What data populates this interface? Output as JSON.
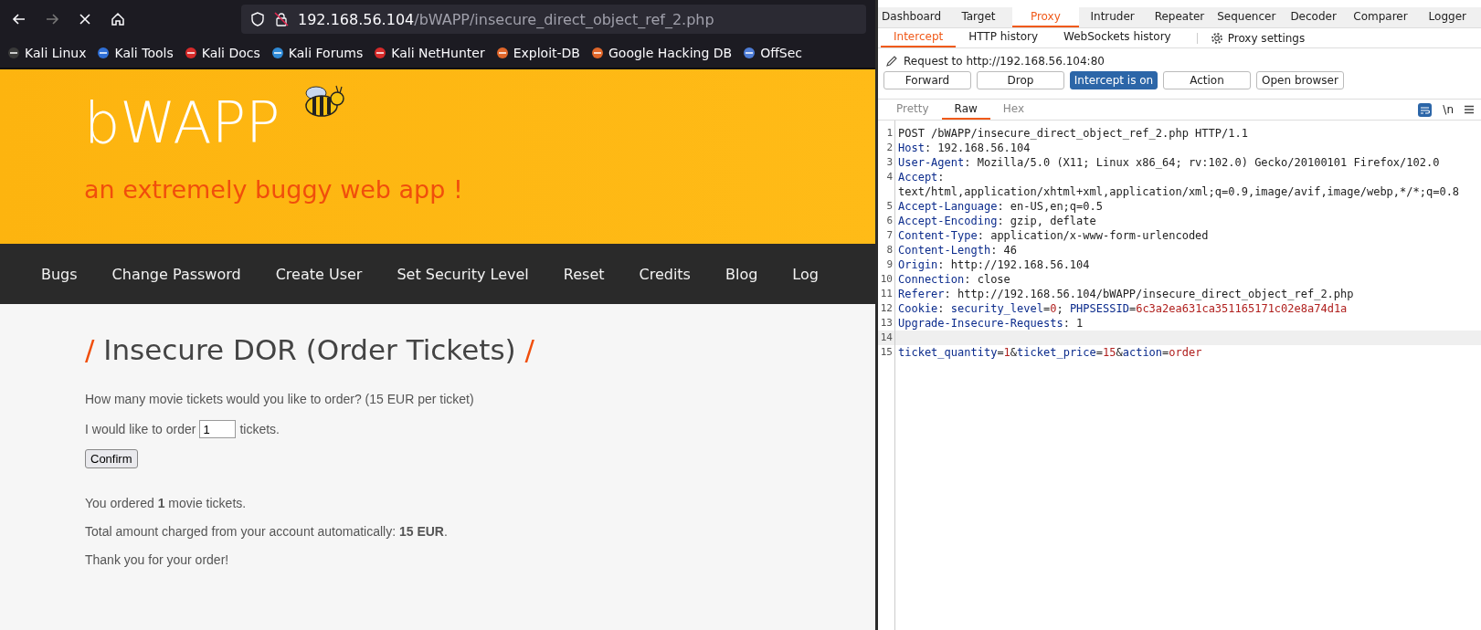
{
  "browser": {
    "url": {
      "host": "192.168.56.104",
      "path": "/bWAPP/insecure_direct_object_ref_2.php"
    },
    "bookmarks": [
      "Kali Linux",
      "Kali Tools",
      "Kali Docs",
      "Kali Forums",
      "Kali NetHunter",
      "Exploit-DB",
      "Google Hacking DB",
      "OffSec"
    ]
  },
  "site": {
    "logo": "bWAPP",
    "tagline": "an extremely buggy web app !",
    "nav": [
      "Bugs",
      "Change Password",
      "Create User",
      "Set Security Level",
      "Reset",
      "Credits",
      "Blog",
      "Log"
    ],
    "heading": {
      "slash": "/",
      "title": "Insecure DOR (Order Tickets)"
    },
    "question": "How many movie tickets would you like to order? (15 EUR per ticket)",
    "order_prefix": "I would like to order",
    "quantity": "1",
    "order_suffix": "tickets.",
    "confirm": "Confirm",
    "results": [
      "You ordered **1** movie tickets.",
      "Total amount charged from your account automatically: **15 EUR**.",
      "Thank you for your order!"
    ]
  },
  "burp": {
    "tabs": [
      {
        "label": "Dashboard",
        "selected": false
      },
      {
        "label": "Target",
        "selected": false
      },
      {
        "label": "Proxy",
        "selected": true
      },
      {
        "label": "Intruder",
        "selected": false
      },
      {
        "label": "Repeater",
        "selected": false
      },
      {
        "label": "Sequencer",
        "selected": false
      },
      {
        "label": "Decoder",
        "selected": false
      },
      {
        "label": "Comparer",
        "selected": false
      },
      {
        "label": "Logger",
        "selected": false
      }
    ],
    "subtabs": [
      {
        "label": "Intercept",
        "selected": true
      },
      {
        "label": "HTTP history",
        "selected": false
      },
      {
        "label": "WebSockets history",
        "selected": false
      }
    ],
    "settings": "Proxy settings",
    "request_to": "Request to http://192.168.56.104:80",
    "buttons": [
      {
        "label": "Forward",
        "on": false
      },
      {
        "label": "Drop",
        "on": false
      },
      {
        "label": "Intercept is on",
        "on": true
      },
      {
        "label": "Action",
        "on": false
      },
      {
        "label": "Open browser",
        "on": false
      }
    ],
    "editor_tabs": [
      {
        "label": "Pretty",
        "selected": false
      },
      {
        "label": "Raw",
        "selected": true
      },
      {
        "label": "Hex",
        "selected": false
      }
    ],
    "newline_toggle": "\\n",
    "lines": [
      {
        "number": "1",
        "highlighted": false,
        "segments": [
          {
            "kind": "plain",
            "text": "POST /bWAPP/insecure_direct_object_ref_2.php HTTP/1.1"
          }
        ]
      },
      {
        "number": "2",
        "highlighted": false,
        "segments": [
          {
            "kind": "key",
            "text": "Host"
          },
          {
            "kind": "plain",
            "text": ": 192.168.56.104"
          }
        ]
      },
      {
        "number": "3",
        "highlighted": false,
        "segments": [
          {
            "kind": "key",
            "text": "User-Agent"
          },
          {
            "kind": "plain",
            "text": ": Mozilla/5.0 (X11; Linux x86_64; rv:102.0) Gecko/20100101 Firefox/102.0"
          }
        ]
      },
      {
        "number": "4",
        "highlighted": false,
        "segments": [
          {
            "kind": "key",
            "text": "Accept"
          },
          {
            "kind": "plain",
            "text": ":"
          }
        ],
        "wrapped": "text/html,application/xhtml+xml,application/xml;q=0.9,image/avif,image/webp,*/*;q=0.8"
      },
      {
        "number": "5",
        "highlighted": false,
        "segments": [
          {
            "kind": "key",
            "text": "Accept-Language"
          },
          {
            "kind": "plain",
            "text": ": en-US,en;q=0.5"
          }
        ]
      },
      {
        "number": "6",
        "highlighted": false,
        "segments": [
          {
            "kind": "key",
            "text": "Accept-Encoding"
          },
          {
            "kind": "plain",
            "text": ": gzip, deflate"
          }
        ]
      },
      {
        "number": "7",
        "highlighted": false,
        "segments": [
          {
            "kind": "key",
            "text": "Content-Type"
          },
          {
            "kind": "plain",
            "text": ": application/x-www-form-urlencoded"
          }
        ]
      },
      {
        "number": "8",
        "highlighted": false,
        "segments": [
          {
            "kind": "key",
            "text": "Content-Length"
          },
          {
            "kind": "plain",
            "text": ": 46"
          }
        ]
      },
      {
        "number": "9",
        "highlighted": false,
        "segments": [
          {
            "kind": "key",
            "text": "Origin"
          },
          {
            "kind": "plain",
            "text": ": http://192.168.56.104"
          }
        ]
      },
      {
        "number": "10",
        "highlighted": false,
        "segments": [
          {
            "kind": "key",
            "text": "Connection"
          },
          {
            "kind": "plain",
            "text": ": close"
          }
        ]
      },
      {
        "number": "11",
        "highlighted": false,
        "segments": [
          {
            "kind": "key",
            "text": "Referer"
          },
          {
            "kind": "plain",
            "text": ": http://192.168.56.104/bWAPP/insecure_direct_object_ref_2.php"
          }
        ]
      },
      {
        "number": "12",
        "highlighted": false,
        "segments": [
          {
            "kind": "key",
            "text": "Cookie"
          },
          {
            "kind": "plain",
            "text": ": "
          },
          {
            "kind": "key",
            "text": "security_level"
          },
          {
            "kind": "plain",
            "text": "="
          },
          {
            "kind": "value",
            "text": "0"
          },
          {
            "kind": "plain",
            "text": "; "
          },
          {
            "kind": "key",
            "text": "PHPSESSID"
          },
          {
            "kind": "plain",
            "text": "="
          },
          {
            "kind": "value",
            "text": "6c3a2ea631ca351165171c02e8a74d1a"
          }
        ]
      },
      {
        "number": "13",
        "highlighted": false,
        "segments": [
          {
            "kind": "key",
            "text": "Upgrade-Insecure-Requests"
          },
          {
            "kind": "plain",
            "text": ": 1"
          }
        ]
      },
      {
        "number": "14",
        "highlighted": true
      },
      {
        "number": "15",
        "highlighted": false,
        "segments": [
          {
            "kind": "key",
            "text": "ticket_quantity"
          },
          {
            "kind": "plain",
            "text": "="
          },
          {
            "kind": "value",
            "text": "1"
          },
          {
            "kind": "plain",
            "text": "&"
          },
          {
            "kind": "key",
            "text": "ticket_price"
          },
          {
            "kind": "plain",
            "text": "="
          },
          {
            "kind": "value",
            "text": "15"
          },
          {
            "kind": "plain",
            "text": "&"
          },
          {
            "kind": "key",
            "text": "action"
          },
          {
            "kind": "plain",
            "text": "="
          },
          {
            "kind": "value",
            "text": "order"
          }
        ]
      }
    ]
  }
}
